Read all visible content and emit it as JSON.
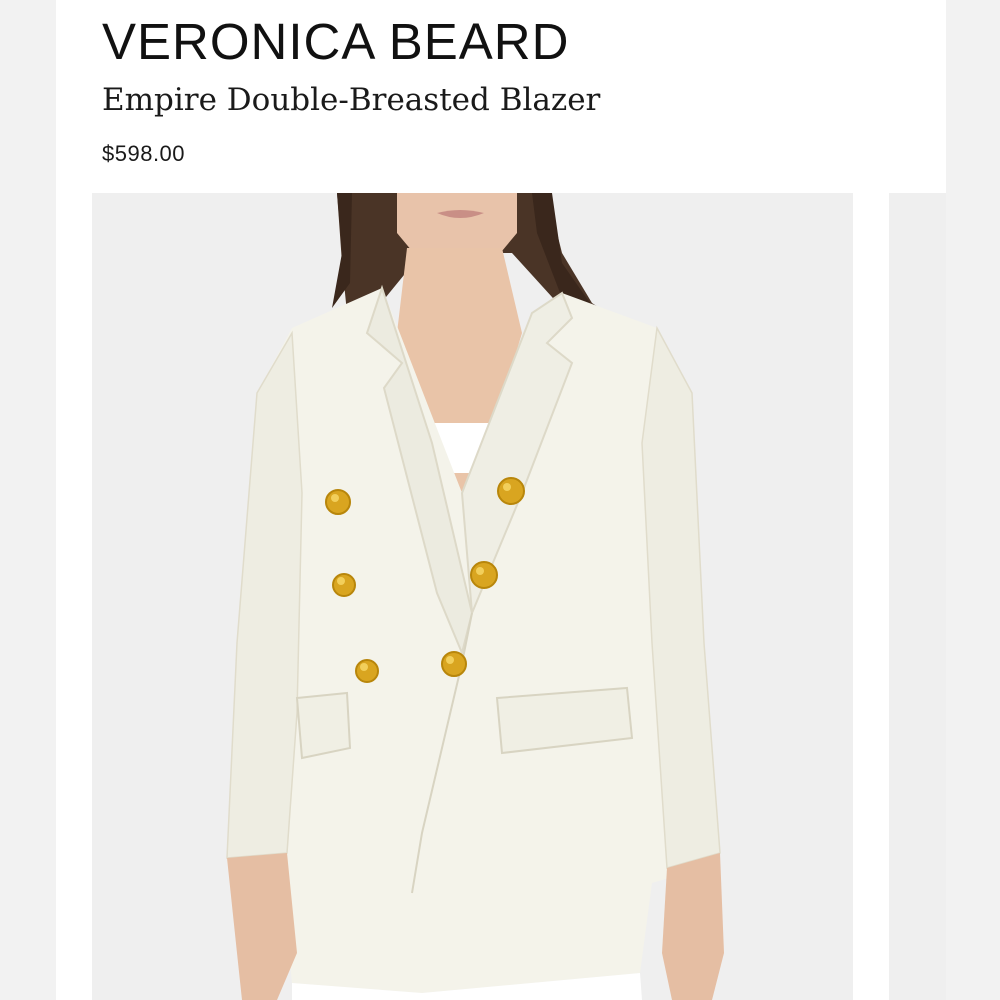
{
  "product": {
    "brand": "VERONICA BEARD",
    "name": "Empire Double-Breasted Blazer",
    "price": "$598.00"
  },
  "image": {
    "icon": "product-photo",
    "colors": {
      "background": "#efefef",
      "blazer": "#f4f3ea",
      "buttons": "#d9a520",
      "hair": "#4a3426",
      "skin": "#e8c3aa"
    }
  }
}
